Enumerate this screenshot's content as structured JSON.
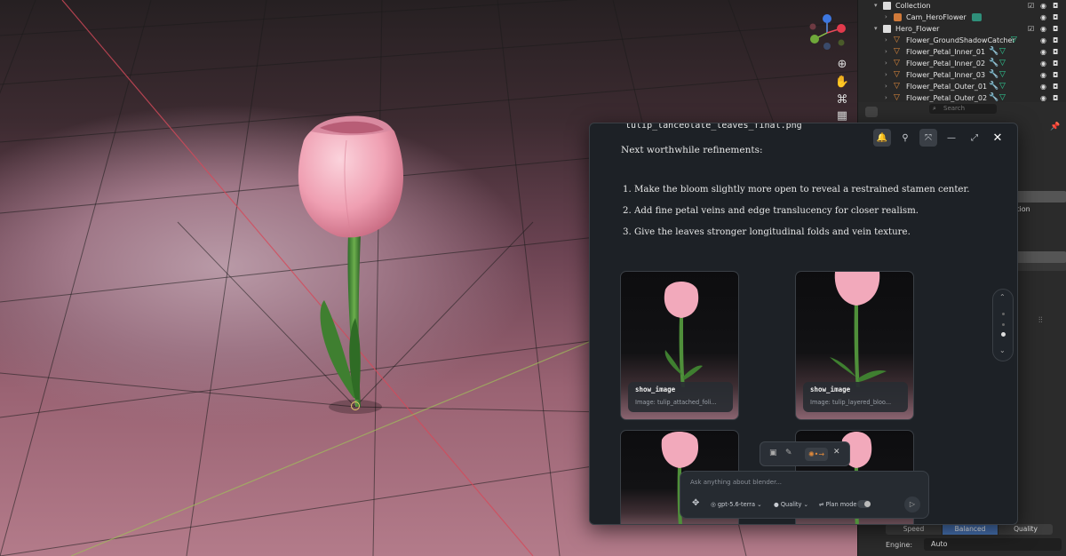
{
  "outliner": {
    "rows": [
      {
        "label": "Collection",
        "kind": "collection"
      },
      {
        "label": "Cam_HeroFlower",
        "kind": "camera"
      },
      {
        "label": "Hero_Flower",
        "kind": "collection"
      },
      {
        "label": "Flower_GroundShadowCatcher",
        "kind": "mesh"
      },
      {
        "label": "Flower_Petal_Inner_01",
        "kind": "mesh"
      },
      {
        "label": "Flower_Petal_Inner_02",
        "kind": "mesh"
      },
      {
        "label": "Flower_Petal_Inner_03",
        "kind": "mesh"
      },
      {
        "label": "Flower_Petal_Outer_01",
        "kind": "mesh"
      },
      {
        "label": "Flower_Petal_Outer_02",
        "kind": "mesh"
      }
    ]
  },
  "properties": {
    "search_placeholder": "Search",
    "partial_label": "ction",
    "segments": [
      "Speed",
      "Balanced",
      "Quality"
    ],
    "active_segment": "Balanced",
    "engine_label": "Engine:",
    "engine_value": "Auto"
  },
  "assistant": {
    "filename": "tulip_lanceolate_leaves_final.png",
    "heading": "Next worthwhile refinements:",
    "list": [
      "1. Make the bloom slightly more open to reveal a restrained stamen center.",
      "2. Add fine petal veins and edge translucency for closer realism.",
      "3. Give the leaves stronger longitudinal folds and vein texture."
    ],
    "cards": [
      {
        "title": "show_image",
        "subtitle": "Image: tulip_attached_foli..."
      },
      {
        "title": "show_image",
        "subtitle": "Image: tulip_layered_bloo..."
      }
    ],
    "composer": {
      "placeholder": "Ask anything about blender...",
      "model": "gpt-5.6-terra",
      "quality": "Quality",
      "plan_mode": "Plan mode"
    }
  },
  "colors": {
    "accent": "#4772b3",
    "mesh_icon": "#e08a3c",
    "modifier_icon": "#5aa0e0",
    "data_icon": "#2fd39a",
    "viewport_floor": "#9a6373"
  }
}
